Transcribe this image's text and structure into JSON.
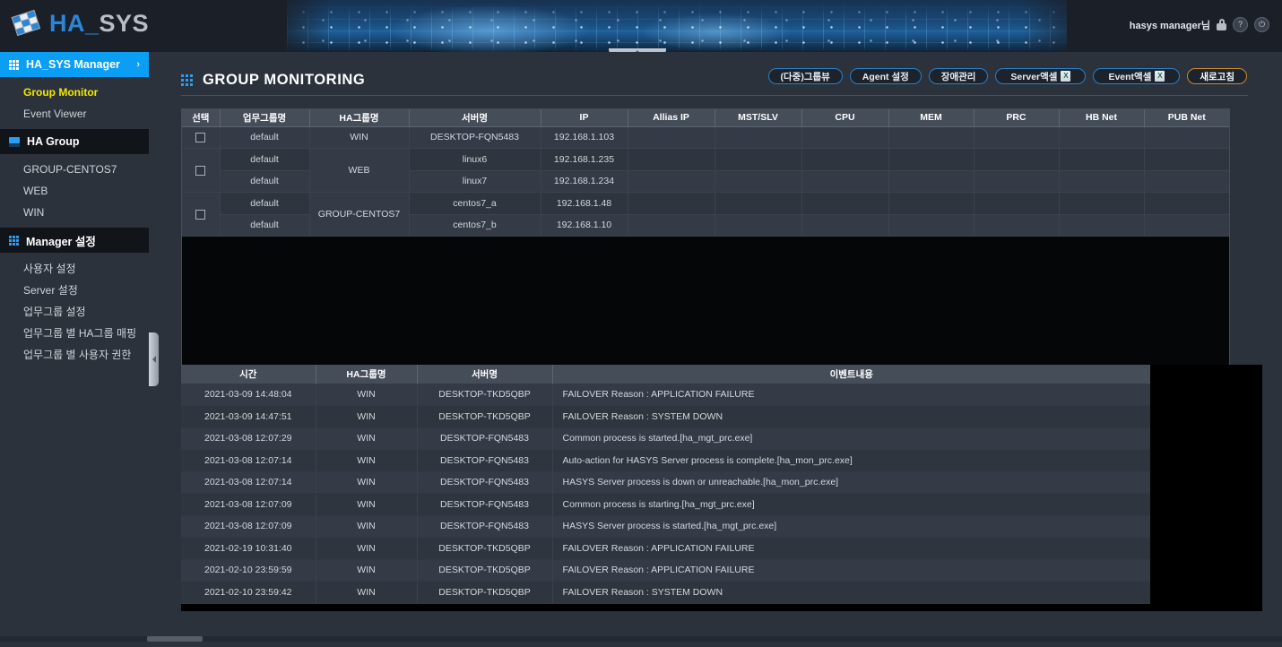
{
  "app": {
    "logo_text_a": "HA_",
    "logo_text_b": "SYS",
    "user_label": "hasys manager님",
    "icon_lock": "lock-icon",
    "icon_help": "?",
    "icon_power": "⏻"
  },
  "sidebar": {
    "sections": [
      {
        "title": "HA_SYS Manager",
        "icon": "grid-icon",
        "active": true,
        "chevron": "›",
        "items": [
          {
            "label": "Group Monitor",
            "selected": true
          },
          {
            "label": "Event Viewer",
            "selected": false
          }
        ]
      },
      {
        "title": "HA Group",
        "icon": "server-icon",
        "active": false,
        "items": [
          {
            "label": "GROUP-CENTOS7",
            "selected": false
          },
          {
            "label": "WEB",
            "selected": false
          },
          {
            "label": "WIN",
            "selected": false
          }
        ]
      },
      {
        "title": "Manager 설정",
        "icon": "grid-icon",
        "active": false,
        "items": [
          {
            "label": "사용자 설정",
            "selected": false
          },
          {
            "label": "Server 설정",
            "selected": false
          },
          {
            "label": "업무그룹 설정",
            "selected": false
          },
          {
            "label": "업무그룹 별 HA그룹 매핑",
            "selected": false
          },
          {
            "label": "업무그룹 별 사용자 권한",
            "selected": false
          }
        ]
      }
    ]
  },
  "page": {
    "title": "GROUP MONITORING",
    "toolbar": [
      {
        "label": "(다중)그룹뷰",
        "excel": false,
        "accent": false
      },
      {
        "label": "Agent 설정",
        "excel": false,
        "accent": false
      },
      {
        "label": "장애관리",
        "excel": false,
        "accent": false
      },
      {
        "label": "Server액셀",
        "excel": true,
        "accent": false
      },
      {
        "label": "Event액셀",
        "excel": true,
        "accent": false
      },
      {
        "label": "새로고침",
        "excel": false,
        "accent": true
      }
    ],
    "excel_glyph": "X"
  },
  "monitor_table": {
    "headers": [
      "선택",
      "업무그룹명",
      "HA그룹명",
      "서버명",
      "IP",
      "Allias IP",
      "MST/SLV",
      "CPU",
      "MEM",
      "PRC",
      "HB Net",
      "PUB Net"
    ],
    "groups": [
      {
        "ha_group": "WIN",
        "rows": [
          {
            "biz_group": "default",
            "server": "DESKTOP-FQN5483",
            "ip": "192.168.1.103",
            "allias_ip": "",
            "mst_slv": "",
            "cpu": "",
            "mem": "",
            "prc": "",
            "hb_net": "",
            "pub_net": ""
          }
        ]
      },
      {
        "ha_group": "WEB",
        "rows": [
          {
            "biz_group": "default",
            "server": "linux6",
            "ip": "192.168.1.235",
            "allias_ip": "",
            "mst_slv": "",
            "cpu": "",
            "mem": "",
            "prc": "",
            "hb_net": "",
            "pub_net": ""
          },
          {
            "biz_group": "default",
            "server": "linux7",
            "ip": "192.168.1.234",
            "allias_ip": "",
            "mst_slv": "",
            "cpu": "",
            "mem": "",
            "prc": "",
            "hb_net": "",
            "pub_net": ""
          }
        ]
      },
      {
        "ha_group": "GROUP-CENTOS7",
        "rows": [
          {
            "biz_group": "default",
            "server": "centos7_a",
            "ip": "192.168.1.48",
            "allias_ip": "",
            "mst_slv": "",
            "cpu": "",
            "mem": "",
            "prc": "",
            "hb_net": "",
            "pub_net": ""
          },
          {
            "biz_group": "default",
            "server": "centos7_b",
            "ip": "192.168.1.10",
            "allias_ip": "",
            "mst_slv": "",
            "cpu": "",
            "mem": "",
            "prc": "",
            "hb_net": "",
            "pub_net": ""
          }
        ]
      }
    ]
  },
  "scroll_buttons": {
    "up": "▲",
    "down": "▼"
  },
  "event_table": {
    "headers": [
      "시간",
      "HA그룹명",
      "서버명",
      "이벤트내용"
    ],
    "rows": [
      {
        "time": "2021-03-09 14:48:04",
        "ha_group": "WIN",
        "server": "DESKTOP-TKD5QBP",
        "message": "FAILOVER Reason : APPLICATION FAILURE",
        "severity": "red"
      },
      {
        "time": "2021-03-09 14:47:51",
        "ha_group": "WIN",
        "server": "DESKTOP-TKD5QBP",
        "message": "FAILOVER Reason : SYSTEM DOWN",
        "severity": "red"
      },
      {
        "time": "2021-03-08 12:07:29",
        "ha_group": "WIN",
        "server": "DESKTOP-FQN5483",
        "message": "Common process is started.[ha_mgt_prc.exe]",
        "severity": "normal"
      },
      {
        "time": "2021-03-08 12:07:14",
        "ha_group": "WIN",
        "server": "DESKTOP-FQN5483",
        "message": "Auto-action for HASYS Server process is complete.[ha_mon_prc.exe]",
        "severity": "normal"
      },
      {
        "time": "2021-03-08 12:07:14",
        "ha_group": "WIN",
        "server": "DESKTOP-FQN5483",
        "message": "HASYS Server process is down or unreachable.[ha_mon_prc.exe]",
        "severity": "magenta"
      },
      {
        "time": "2021-03-08 12:07:09",
        "ha_group": "WIN",
        "server": "DESKTOP-FQN5483",
        "message": "Common process is starting.[ha_mgt_prc.exe]",
        "severity": "normal"
      },
      {
        "time": "2021-03-08 12:07:09",
        "ha_group": "WIN",
        "server": "DESKTOP-FQN5483",
        "message": "HASYS Server process is started.[ha_mgt_prc.exe]",
        "severity": "normal"
      },
      {
        "time": "2021-02-19 10:31:40",
        "ha_group": "WIN",
        "server": "DESKTOP-TKD5QBP",
        "message": "FAILOVER Reason : APPLICATION FAILURE",
        "severity": "red"
      },
      {
        "time": "2021-02-10 23:59:59",
        "ha_group": "WIN",
        "server": "DESKTOP-TKD5QBP",
        "message": "FAILOVER Reason : APPLICATION FAILURE",
        "severity": "red"
      },
      {
        "time": "2021-02-10 23:59:42",
        "ha_group": "WIN",
        "server": "DESKTOP-TKD5QBP",
        "message": "FAILOVER Reason : SYSTEM DOWN",
        "severity": "red"
      }
    ]
  },
  "colors": {
    "accent_blue": "#2a9df4",
    "selected_yellow": "#f3e800",
    "alert_red": "#ff1414",
    "alert_magenta": "#ff2fd2",
    "refresh_border": "#c98b2a"
  }
}
